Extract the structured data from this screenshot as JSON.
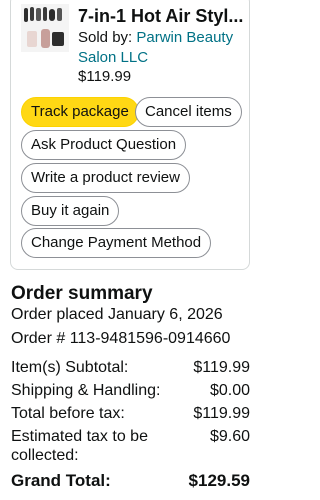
{
  "product": {
    "title": "7-in-1 Hot Air Styl...",
    "sold_by_prefix": "Sold by: ",
    "seller_name": "Parwin Beauty Salon LLC",
    "price": "$119.99"
  },
  "actions": {
    "track": "Track package",
    "cancel": "Cancel items",
    "ask": "Ask Product Question",
    "review": "Write a product review",
    "buy_again": "Buy it again",
    "change_payment": "Change Payment Method"
  },
  "summary": {
    "title": "Order summary",
    "placed": "Order placed January 6, 2026",
    "order_number": "Order # 113-9481596-0914660",
    "rows": [
      {
        "label": "Item(s) Subtotal:",
        "value": "$119.99"
      },
      {
        "label": "Shipping & Handling:",
        "value": "$0.00"
      },
      {
        "label": "Total before tax:",
        "value": "$119.99"
      },
      {
        "label": "Estimated tax to be collected:",
        "value": "$9.60"
      },
      {
        "label": "Grand Total:",
        "value": "$129.59"
      }
    ]
  },
  "colors": {
    "accent_button": "#ffd814",
    "link": "#007185",
    "text": "#0f1111",
    "border": "#d5d9d9"
  }
}
